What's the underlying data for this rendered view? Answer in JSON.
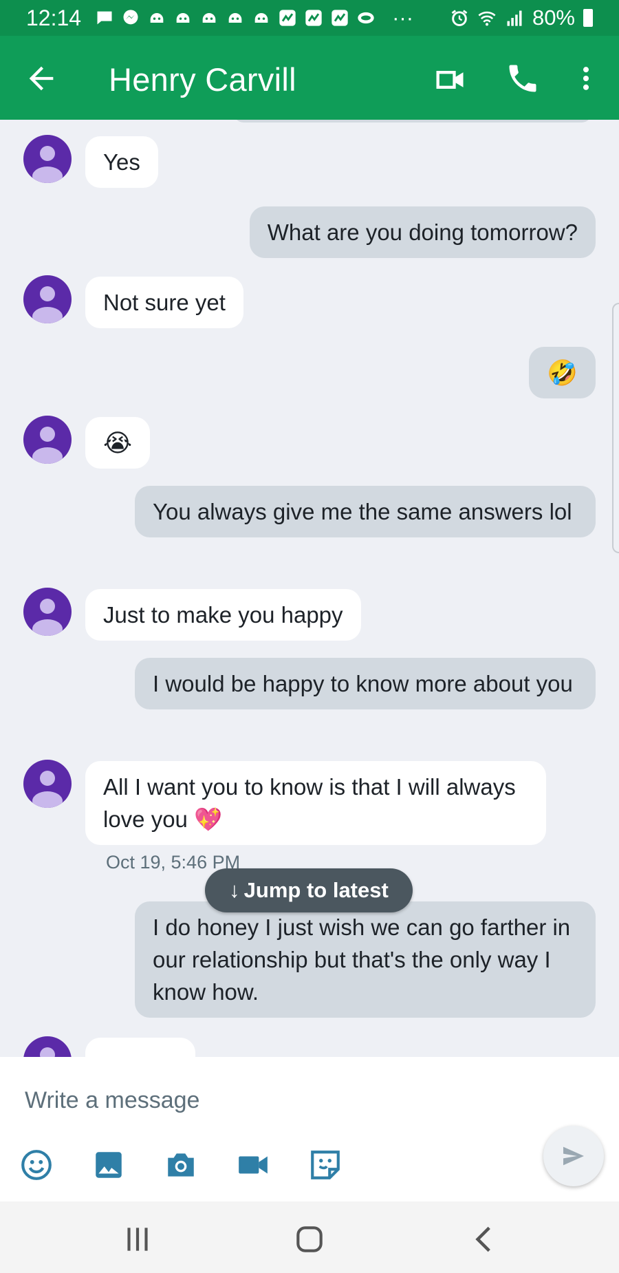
{
  "status_bar": {
    "time": "12:14",
    "overflow": "···",
    "battery": "80%",
    "icons": [
      "message-icon",
      "messenger-icon",
      "game-icon",
      "game-icon",
      "game-icon",
      "game-icon",
      "game-icon",
      "app-icon",
      "app-icon",
      "app-icon",
      "chat-icon",
      "alarm-icon",
      "wifi-icon",
      "signal-icon",
      "battery-icon"
    ]
  },
  "header": {
    "contact_name": "Henry Carvill",
    "icons": [
      "back-arrow-icon",
      "video-call-icon",
      "phone-icon",
      "more-vert-icon"
    ]
  },
  "messages": [
    {
      "direction": "incoming",
      "text": "Yes"
    },
    {
      "direction": "outgoing",
      "text": "What are you doing tomorrow?"
    },
    {
      "direction": "incoming",
      "text": "Not sure yet"
    },
    {
      "direction": "outgoing",
      "text": "🤣"
    },
    {
      "direction": "incoming",
      "text": "😭"
    },
    {
      "direction": "outgoing",
      "text": "You always give me the same answers lol"
    },
    {
      "direction": "incoming",
      "text": "Just to make you happy"
    },
    {
      "direction": "outgoing",
      "text": "I would be happy to know more about you"
    },
    {
      "direction": "incoming",
      "text": "All I want you to know is that I will always love you 💖",
      "timestamp": "Oct 19, 5:46 PM"
    },
    {
      "direction": "outgoing",
      "text": "I do honey I just wish we can go farther in our relationship but that's the only way I know how."
    }
  ],
  "jump_button": {
    "label": "Jump to latest",
    "arrow": "↓"
  },
  "composer": {
    "placeholder": "Write a message",
    "value": "",
    "tools": [
      "emoji-icon",
      "gallery-icon",
      "camera-icon",
      "video-camera-icon",
      "sticker-icon"
    ],
    "send_icon": "send-icon"
  },
  "nav_bar": {
    "icons": [
      "recents-icon",
      "home-icon",
      "back-icon"
    ]
  },
  "colors": {
    "status_bar": "#0d8f4e",
    "app_bar": "#0f9d58",
    "avatar": "#5b2aa8",
    "incoming_bubble": "#ffffff",
    "outgoing_bubble": "#d2d9e0",
    "background": "#eef0f5"
  }
}
